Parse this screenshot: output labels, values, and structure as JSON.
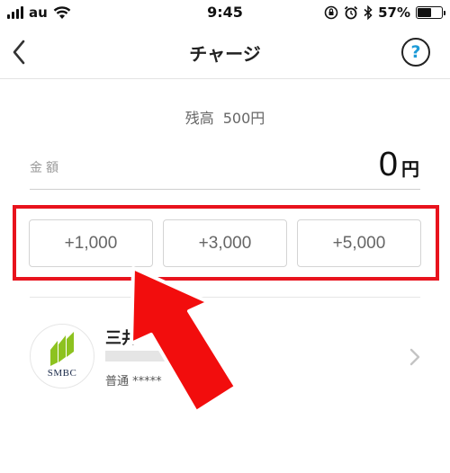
{
  "status_bar": {
    "carrier": "au",
    "time": "9:45",
    "battery_percent": "57%",
    "battery_level": 0.57
  },
  "nav": {
    "title": "チャージ",
    "help_label": "?"
  },
  "balance": {
    "label": "残高",
    "value": "500円"
  },
  "amount": {
    "label": "金額",
    "value": "0",
    "unit": "円"
  },
  "quick_amounts": [
    {
      "label": "+1,000"
    },
    {
      "label": "+3,000"
    },
    {
      "label": "+5,000"
    }
  ],
  "bank": {
    "name": "三井",
    "logo_text": "SMBC",
    "account": "普通 *****",
    "logo_color": "#8dc21f"
  },
  "colors": {
    "highlight": "#e8131d",
    "help_accent": "#1e9bd7"
  }
}
